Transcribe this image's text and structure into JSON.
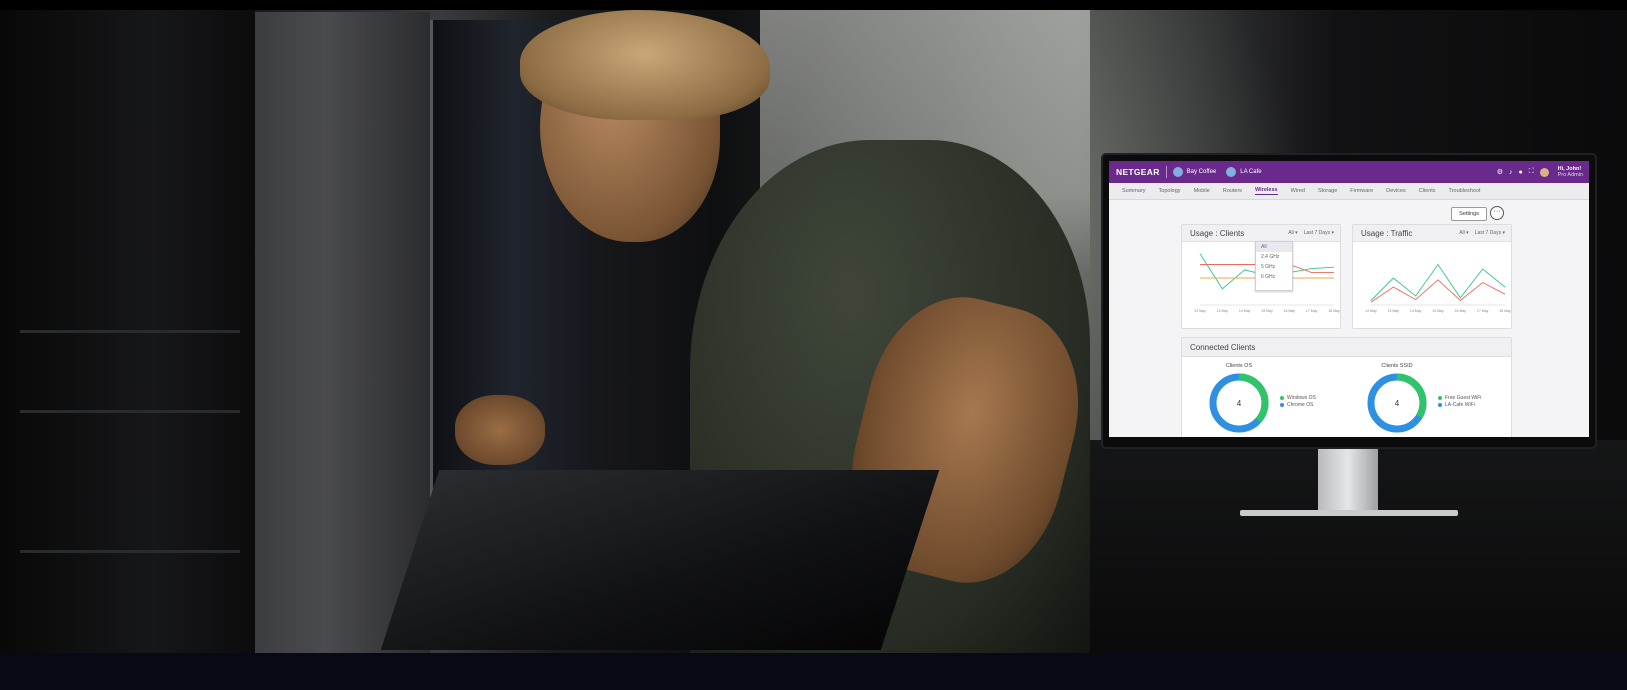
{
  "netgear": {
    "logo": "NETGEAR",
    "org": "Bay Coffee",
    "location": "LA Cafe",
    "user_greeting": "Hi, John!",
    "user_role": "Pro Admin",
    "tabs": [
      "Summary",
      "Topology",
      "Mobile",
      "Routers",
      "Wireless",
      "Wired",
      "Storage",
      "Firmware",
      "Devices",
      "Clients",
      "Troubleshoot"
    ],
    "active_tab": "Wireless",
    "settings_label": "Settings",
    "more_label": "···"
  },
  "usage_clients": {
    "title": "Usage : Clients",
    "filter_band": "All ▾",
    "filter_range": "Last 7 Days ▾",
    "dropdown_options": [
      "All",
      "2.4 GHz",
      "5 GHz",
      "6 GHz"
    ]
  },
  "usage_traffic": {
    "title": "Usage : Traffic",
    "filter_band": "All ▾",
    "filter_range": "Last 7 Days ▾"
  },
  "connected_clients": {
    "title": "Connected Clients",
    "os_title": "Clients OS",
    "os_count": "4",
    "os_legend": [
      "Windows OS",
      "Chrome OS"
    ],
    "ssid_title": "Clients SSID",
    "ssid_count": "4",
    "ssid_legend": [
      "Free Guest WiFi",
      "LA-Cafe WiFi"
    ]
  },
  "colors": {
    "brand_purple": "#6a2a8c",
    "series_green": "#35c48a",
    "series_red": "#e86a5a",
    "series_orange": "#f2a640",
    "donut_blue": "#2f8fe0",
    "donut_green": "#2fc46a"
  },
  "chart_data": [
    {
      "type": "line",
      "title": "Usage : Clients",
      "categories": [
        "12 May",
        "13 May",
        "14 May",
        "15 May",
        "16 May",
        "17 May",
        "18 May"
      ],
      "series": [
        {
          "values": [
            3.8,
            1.2,
            2.6,
            2.2,
            2.4,
            2.7,
            2.8
          ]
        },
        {
          "values": [
            3.0,
            3.0,
            3.0,
            3.0,
            3.0,
            2.4,
            2.4
          ]
        },
        {
          "values": [
            2.0,
            2.0,
            2.0,
            2.0,
            2.0,
            2.0,
            2.0
          ]
        }
      ],
      "ylim": [
        0,
        4
      ]
    },
    {
      "type": "line",
      "title": "Usage : Traffic",
      "categories": [
        "12 May",
        "13 May",
        "14 May",
        "15 May",
        "16 May",
        "17 May",
        "18 May"
      ],
      "series": [
        {
          "values": [
            5,
            30,
            10,
            45,
            8,
            40,
            20
          ]
        },
        {
          "values": [
            3,
            20,
            6,
            28,
            5,
            25,
            12
          ]
        }
      ],
      "ylim": [
        0,
        60
      ]
    }
  ]
}
